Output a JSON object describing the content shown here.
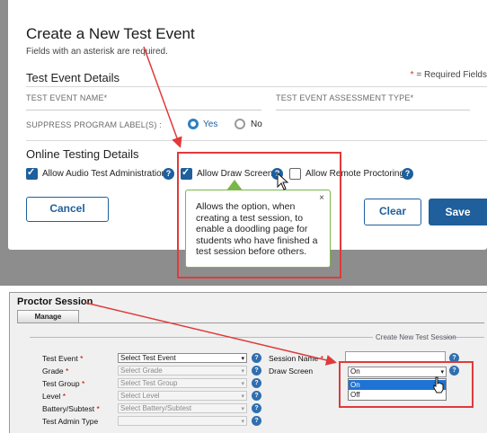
{
  "dialog": {
    "title": "Create a New Test Event",
    "subtitle": "Fields with an asterisk are required.",
    "details_title": "Test Event Details",
    "required_note_star": "*",
    "required_note_text": " = Required Fields",
    "test_event_name_label": "TEST EVENT NAME*",
    "assessment_type_label": "TEST EVENT ASSESSMENT TYPE*",
    "suppress_label": "SUPPRESS PROGRAM LABEL(S) :",
    "radio_yes": "Yes",
    "radio_no": "No",
    "online_title": "Online Testing Details",
    "checkboxes": [
      {
        "label": "Allow Audio Test Administration",
        "checked": true
      },
      {
        "label": "Allow Draw Screen",
        "checked": true
      },
      {
        "label": "Allow Remote Proctoring",
        "checked": false
      }
    ],
    "help_glyph": "?",
    "tooltip_text": "Allows the option, when creating a test session, to enable a doodling page for students who have finished a test session before others.",
    "tooltip_close": "×",
    "cancel_label": "Cancel",
    "clear_label": "Clear",
    "save_label": "Save"
  },
  "proctor": {
    "title": "Proctor Session",
    "tab_label": "Manage",
    "legend": "Create New Test Session",
    "test_event_label": "Test Event",
    "test_event_value": "Select Test Event",
    "grade_label": "Grade",
    "grade_value": "Select Grade",
    "test_group_label": "Test Group",
    "test_group_value": "Select Test Group",
    "level_label": "Level",
    "level_value": "Select Level",
    "battery_label": "Battery/Subtest",
    "battery_value": "Select Battery/Subtest",
    "admin_type_label": "Test Admin Type",
    "session_name_label": "Session Name",
    "draw_screen_label": "Draw Screen",
    "draw_screen_value": "On",
    "draw_screen_options": [
      "On",
      "Off"
    ],
    "required_star": "*",
    "dropdown_glyph": "▾",
    "help_glyph": "?"
  },
  "colors": {
    "accent_blue": "#1e5f9c",
    "annotation_red": "#e03a3a",
    "tooltip_green": "#7ab648",
    "selected_option": "#1e73d4"
  }
}
